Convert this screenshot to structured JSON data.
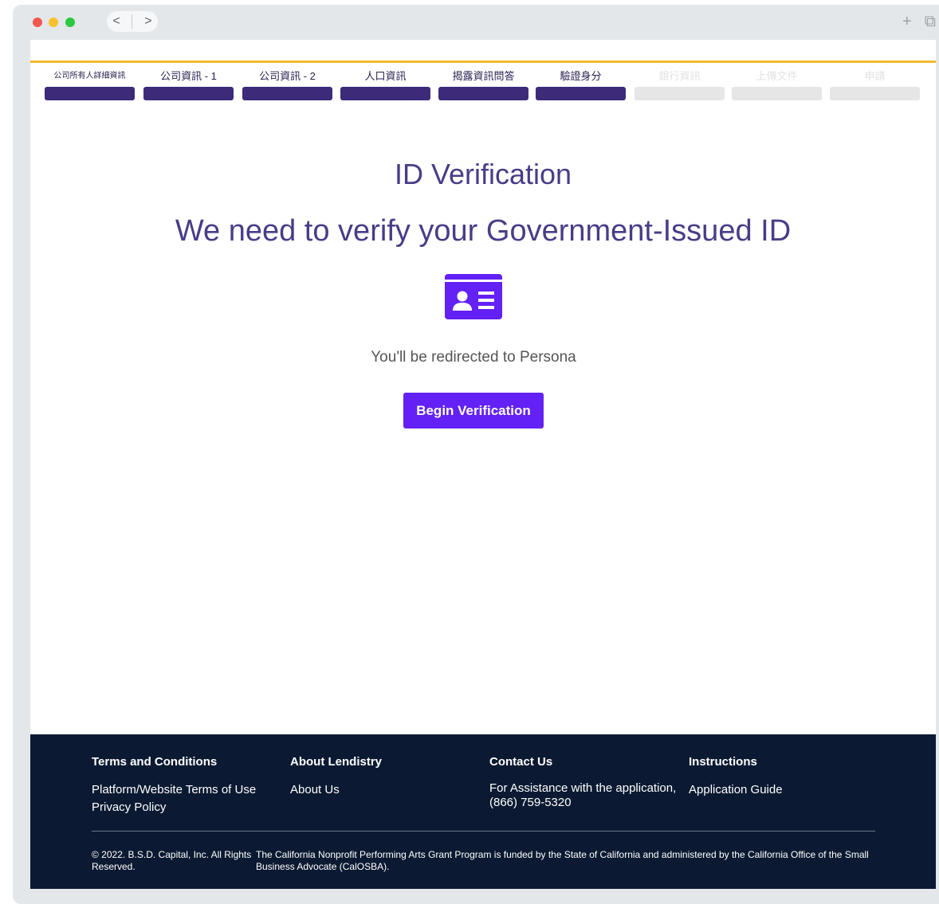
{
  "browser": {
    "back_icon": "<",
    "forward_icon": ">",
    "new_tab_icon": "+",
    "window_icon": "⧉"
  },
  "steps": [
    {
      "label": "公司所有人詳細資訊",
      "state": "complete"
    },
    {
      "label": "公司資訊 - 1",
      "state": "complete"
    },
    {
      "label": "公司資訊 - 2",
      "state": "complete"
    },
    {
      "label": "人口資訊",
      "state": "complete"
    },
    {
      "label": "揭露資訊問答",
      "state": "complete"
    },
    {
      "label": "驗證身分",
      "state": "current"
    },
    {
      "label": "銀行資訊",
      "state": "incomplete"
    },
    {
      "label": "上傳文件",
      "state": "incomplete"
    },
    {
      "label": "申請",
      "state": "incomplete"
    }
  ],
  "main": {
    "title": "ID Verification",
    "subtitle": "We need to verify your Government-Issued ID",
    "icon": "id-card-icon",
    "redirect_text": "You'll be redirected to Persona",
    "button_label": "Begin Verification"
  },
  "footer": {
    "col1": {
      "heading": "Terms and Conditions",
      "links": [
        "Platform/Website Terms of Use",
        "Privacy Policy"
      ]
    },
    "col2": {
      "heading": "About Lendistry",
      "links": [
        "About Us"
      ]
    },
    "col3": {
      "heading": "Contact Us",
      "text1": "For Assistance with the application,",
      "text2": "(866) 759-5320"
    },
    "col4": {
      "heading": "Instructions",
      "links": [
        "Application Guide"
      ]
    },
    "copyright": "© 2022. B.S.D. Capital, Inc. All Rights Reserved.",
    "program": "The California Nonprofit Performing Arts Grant Program is funded by the State of California and administered by the California Office of the Small Business Advocate (CalOSBA)."
  },
  "colors": {
    "accent": "#6321f5",
    "step_complete": "#3d2b7a",
    "step_incomplete": "#e6e6e6",
    "top_border": "#f5b82e",
    "footer_bg": "#0b1a32",
    "heading": "#4a3c88"
  }
}
